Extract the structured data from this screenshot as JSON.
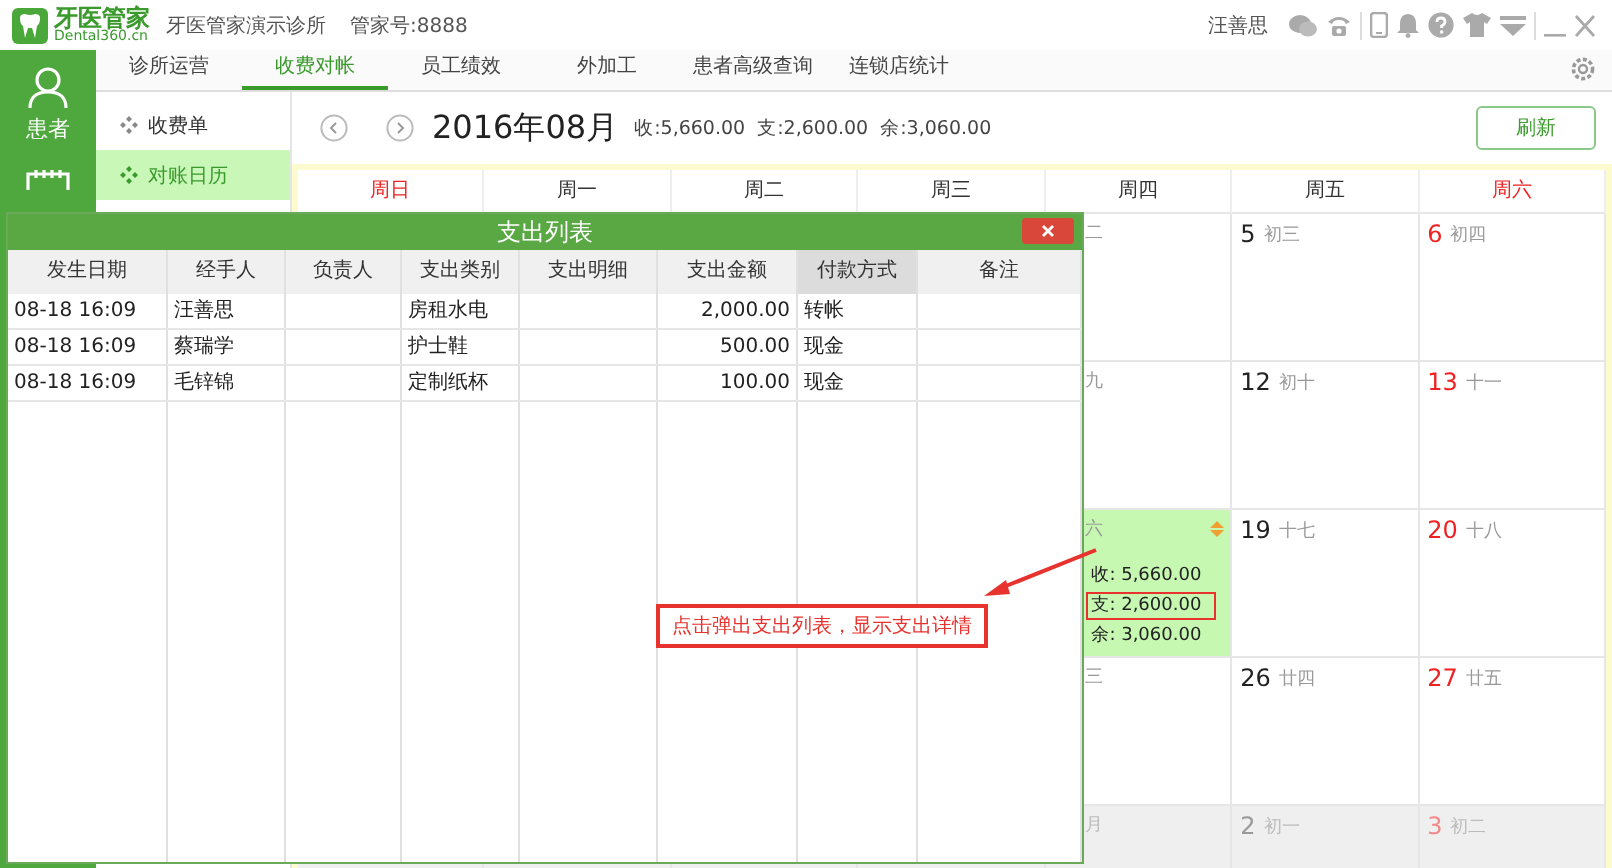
{
  "app": {
    "logo_name": "牙医管家",
    "logo_domain": "Dental360.cn",
    "clinic": "牙医管家演示诊所",
    "account": "管家号:8888",
    "user": "汪善思"
  },
  "sidebar": {
    "items": [
      {
        "kind": "user",
        "label": "患者"
      },
      {
        "kind": "calendar"
      }
    ]
  },
  "tabs": [
    {
      "label": "诊所运营",
      "selected": false
    },
    {
      "label": "收费对帐",
      "selected": true
    },
    {
      "label": "员工绩效",
      "selected": false
    },
    {
      "label": "外加工",
      "selected": false
    },
    {
      "label": "患者高级查询",
      "selected": false
    },
    {
      "label": "连锁店统计",
      "selected": false
    }
  ],
  "submenu": [
    {
      "label": "收费单",
      "selected": false
    },
    {
      "label": "对账日历",
      "selected": true
    }
  ],
  "header": {
    "month": "2016年08月",
    "summary": [
      "收:5,660.00",
      "支:2,600.00",
      "余:3,060.00"
    ],
    "refresh": "刷新"
  },
  "calendar": {
    "weekdays": [
      {
        "label": "周日",
        "weekend": true
      },
      {
        "label": "周一",
        "weekend": false
      },
      {
        "label": "周二",
        "weekend": false
      },
      {
        "label": "周三",
        "weekend": false
      },
      {
        "label": "周四",
        "weekend": false
      },
      {
        "label": "周五",
        "weekend": false
      },
      {
        "label": "周六",
        "weekend": true
      }
    ],
    "rows": [
      [
        {
          "lunar": "二",
          "selected": false,
          "other_month": false
        },
        {
          "day": "5",
          "lunar": "初三",
          "selected": false,
          "other_month": false
        },
        {
          "day": "6",
          "lunar": "初四",
          "selected": false,
          "other_month": false
        }
      ],
      [
        {
          "lunar": "九",
          "selected": false,
          "other_month": false
        },
        {
          "day": "12",
          "lunar": "初十",
          "selected": false,
          "other_month": false
        },
        {
          "day": "13",
          "lunar": "十一",
          "selected": false,
          "other_month": false
        }
      ],
      [
        {
          "lunar": "六",
          "selected": true,
          "other_month": false,
          "stats": [
            {
              "text": "收: 5,660.00",
              "highlighted": false
            },
            {
              "text": "支: 2,600.00",
              "highlighted": true
            },
            {
              "text": "余: 3,060.00",
              "highlighted": false
            }
          ]
        },
        {
          "day": "19",
          "lunar": "十七",
          "selected": false,
          "other_month": false
        },
        {
          "day": "20",
          "lunar": "十八",
          "selected": false,
          "other_month": false
        }
      ],
      [
        {
          "lunar": "三",
          "selected": false,
          "other_month": false
        },
        {
          "day": "26",
          "lunar": "廿四",
          "selected": false,
          "other_month": false
        },
        {
          "day": "27",
          "lunar": "廿五",
          "selected": false,
          "other_month": false
        }
      ],
      [
        {
          "lunar": "月",
          "selected": false,
          "other_month": true
        },
        {
          "day": "2",
          "lunar": "初一",
          "selected": false,
          "other_month": true
        },
        {
          "day": "3",
          "lunar": "初二",
          "selected": false,
          "other_month": true
        }
      ]
    ]
  },
  "dialog": {
    "title": "支出列表",
    "columns": [
      {
        "label": "发生日期",
        "sorted": false
      },
      {
        "label": "经手人",
        "sorted": false
      },
      {
        "label": "负责人",
        "sorted": false
      },
      {
        "label": "支出类别",
        "sorted": false
      },
      {
        "label": "支出明细",
        "sorted": false
      },
      {
        "label": "支出金额",
        "sorted": false
      },
      {
        "label": "付款方式",
        "sorted": true
      },
      {
        "label": "备注",
        "sorted": false
      }
    ],
    "rows": [
      [
        "08-18 16:09",
        "汪善思",
        null,
        "房租水电",
        null,
        "2,000.00",
        "转帐",
        null
      ],
      [
        "08-18 16:09",
        "蔡瑞学",
        null,
        "护士鞋",
        null,
        "500.00",
        "现金",
        null
      ],
      [
        "08-18 16:09",
        "毛锌锦",
        null,
        "定制纸杯",
        null,
        "100.00",
        "现金",
        null
      ]
    ]
  },
  "callout": {
    "text": "点击弹出支出列表，显示支出详情"
  }
}
